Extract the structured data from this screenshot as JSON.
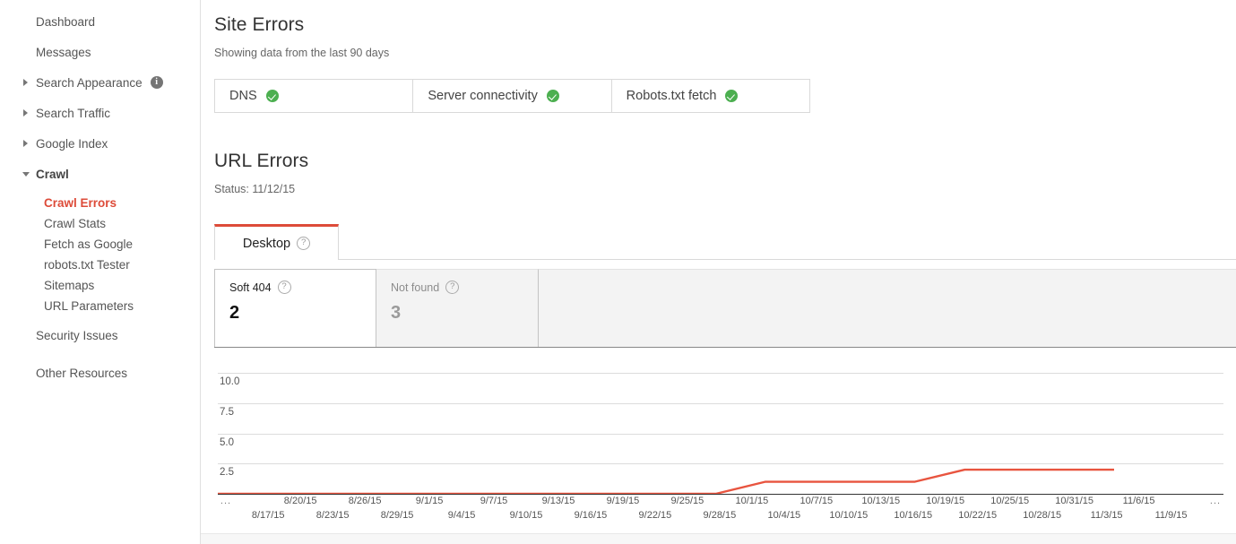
{
  "sidebar": {
    "items": [
      {
        "label": "Dashboard",
        "type": "top",
        "expandable": false
      },
      {
        "label": "Messages",
        "type": "top",
        "expandable": false
      },
      {
        "label": "Search Appearance",
        "type": "top",
        "expandable": true,
        "info_icon": "info-icon",
        "info_glyph": "i"
      },
      {
        "label": "Search Traffic",
        "type": "top",
        "expandable": true
      },
      {
        "label": "Google Index",
        "type": "top",
        "expandable": true
      },
      {
        "label": "Crawl",
        "type": "top",
        "expandable": true,
        "expanded": true
      }
    ],
    "crawl_children": [
      {
        "label": "Crawl Errors",
        "active": true
      },
      {
        "label": "Crawl Stats",
        "active": false
      },
      {
        "label": "Fetch as Google",
        "active": false
      },
      {
        "label": "robots.txt Tester",
        "active": false
      },
      {
        "label": "Sitemaps",
        "active": false
      },
      {
        "label": "URL Parameters",
        "active": false
      }
    ],
    "trailing_items": [
      {
        "label": "Security Issues"
      },
      {
        "label": "Other Resources"
      }
    ],
    "active_color": "#dd4b39"
  },
  "site_errors": {
    "title": "Site Errors",
    "subtitle": "Showing data from the last 90 days",
    "cells": [
      {
        "label": "DNS",
        "status": "ok",
        "status_icon": "green-check-icon"
      },
      {
        "label": "Server connectivity",
        "status": "ok",
        "status_icon": "green-check-icon"
      },
      {
        "label": "Robots.txt fetch",
        "status": "ok",
        "status_icon": "green-check-icon"
      }
    ],
    "ok_color": "#4caf50"
  },
  "url_errors": {
    "title": "URL Errors",
    "status_line": "Status: 11/12/15",
    "tabs": [
      {
        "label": "Desktop",
        "help_icon": "question-mark-icon",
        "help_glyph": "?",
        "selected": true
      }
    ],
    "accent_color": "#dd4b39",
    "cards": [
      {
        "label": "Soft 404",
        "value": "2",
        "selected": true,
        "help_glyph": "?"
      },
      {
        "label": "Not found",
        "value": "3",
        "selected": false,
        "help_glyph": "?"
      }
    ]
  },
  "chart_data": {
    "type": "line",
    "title": "",
    "xlabel": "",
    "ylabel": "",
    "line_color": "#e8543f",
    "ylim": [
      0,
      11.5
    ],
    "y_ticks": [
      10.0,
      7.5,
      5.0,
      2.5
    ],
    "y_tick_labels": [
      "10.0",
      "7.5",
      "5.0",
      "2.5"
    ],
    "grid": true,
    "legend": "none",
    "leading_ellipsis": "...",
    "trailing_ellipsis": "...",
    "x_tick_labels_row0": [
      "8/20/15",
      "8/26/15",
      "9/1/15",
      "9/7/15",
      "9/13/15",
      "9/19/15",
      "9/25/15",
      "10/1/15",
      "10/7/15",
      "10/13/15",
      "10/19/15",
      "10/25/15",
      "10/31/15",
      "11/6/15"
    ],
    "x_tick_labels_row1": [
      "8/17/15",
      "8/23/15",
      "8/29/15",
      "9/4/15",
      "9/10/15",
      "9/16/15",
      "9/22/15",
      "9/28/15",
      "10/4/15",
      "10/10/15",
      "10/16/15",
      "10/22/15",
      "10/28/15",
      "11/3/15",
      "11/9/15"
    ],
    "x": [
      "8/15/15",
      "8/21/15",
      "8/27/15",
      "9/2/15",
      "9/8/15",
      "9/14/15",
      "9/20/15",
      "9/26/15",
      "10/2/15",
      "10/8/15",
      "10/9/15",
      "10/11/15",
      "10/17/15",
      "10/23/15",
      "10/26/15",
      "10/28/15",
      "11/3/15",
      "11/9/15",
      "11/12/15"
    ],
    "values": [
      0,
      0,
      0,
      0,
      0,
      0,
      0,
      0,
      0,
      0,
      0,
      1,
      1,
      1,
      1,
      2,
      2,
      2,
      2
    ],
    "series": [
      {
        "name": "Soft 404",
        "values": [
          0,
          0,
          0,
          0,
          0,
          0,
          0,
          0,
          0,
          0,
          0,
          1,
          1,
          1,
          1,
          2,
          2,
          2,
          2
        ]
      }
    ]
  }
}
